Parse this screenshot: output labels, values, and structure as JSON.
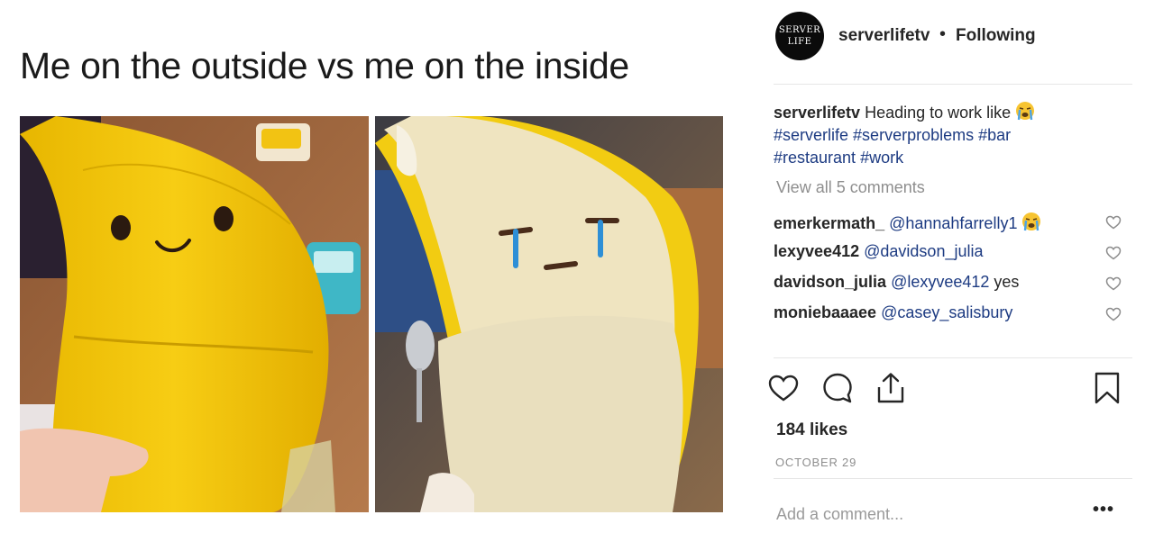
{
  "meme": {
    "caption": "Me on the outside vs me on the inside",
    "left_image": "smiling yellow banana plush",
    "right_image": "peeled banana plush crying"
  },
  "post": {
    "avatar_text_top": "SERVER",
    "avatar_text_bottom": "LIFE",
    "username": "serverlifetv",
    "separator": "•",
    "follow_status": "Following",
    "caption_user": "serverlifetv",
    "caption_text": "Heading to work like",
    "caption_emoji": "crying-face-emoji",
    "hashtags": [
      "#serverlife",
      "#serverproblems",
      "#bar",
      "#restaurant",
      "#work"
    ],
    "view_all_comments": "View all 5 comments",
    "comments": [
      {
        "user": "emerkermath_",
        "mention": "@hannahfarrelly1",
        "text": "",
        "emoji": "crying-face-emoji"
      },
      {
        "user": "lexyvee412",
        "mention": "@davidson_julia",
        "text": "",
        "emoji": ""
      },
      {
        "user": "davidson_julia",
        "mention": "@lexyvee412",
        "text": "yes",
        "emoji": ""
      },
      {
        "user": "moniebaaaee",
        "mention": "@casey_salisbury",
        "text": "",
        "emoji": ""
      }
    ],
    "likes": "184 likes",
    "date": "OCTOBER 29",
    "add_comment_placeholder": "Add a comment...",
    "more_options": "•••"
  },
  "icons": {
    "like": "heart-icon",
    "comment": "comment-bubble-icon",
    "share": "share-icon",
    "save": "bookmark-icon",
    "comment_like": "small-heart-icon"
  },
  "colors": {
    "link": "#1d3b82",
    "muted": "#8e8e8e",
    "text": "#262626",
    "divider": "#e6e6e6"
  }
}
